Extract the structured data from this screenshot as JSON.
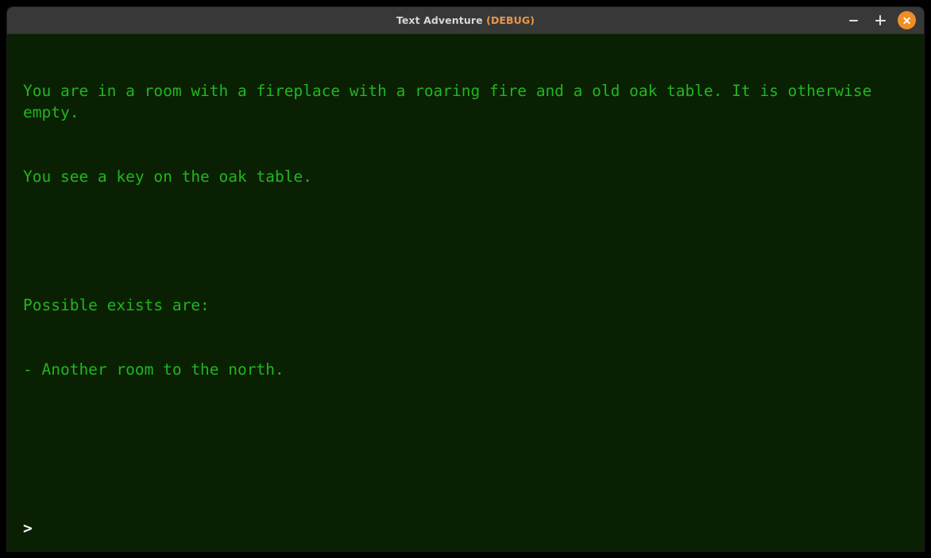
{
  "window": {
    "title_main": "Text Adventure ",
    "title_debug": "(DEBUG)",
    "title_full": "Text Adventure (DEBUG)",
    "titlebar_color": "#383838",
    "controls": {
      "minimize_label": "−",
      "maximize_label": "+",
      "close_label": "×",
      "close_color": "#ef8e28"
    }
  },
  "terminal": {
    "background_color": "#0a2003",
    "text_color": "#21b521",
    "prompt_color": "#f2f2f2",
    "lines": [
      "You are in a room with a fireplace with a roaring fire and a old oak table. It is otherwise empty.",
      "You see a key on the oak table.",
      "",
      "Possible exists are:",
      "- Another room to the north."
    ],
    "prompt_symbol": ">",
    "input_value": "",
    "input_placeholder": ""
  }
}
